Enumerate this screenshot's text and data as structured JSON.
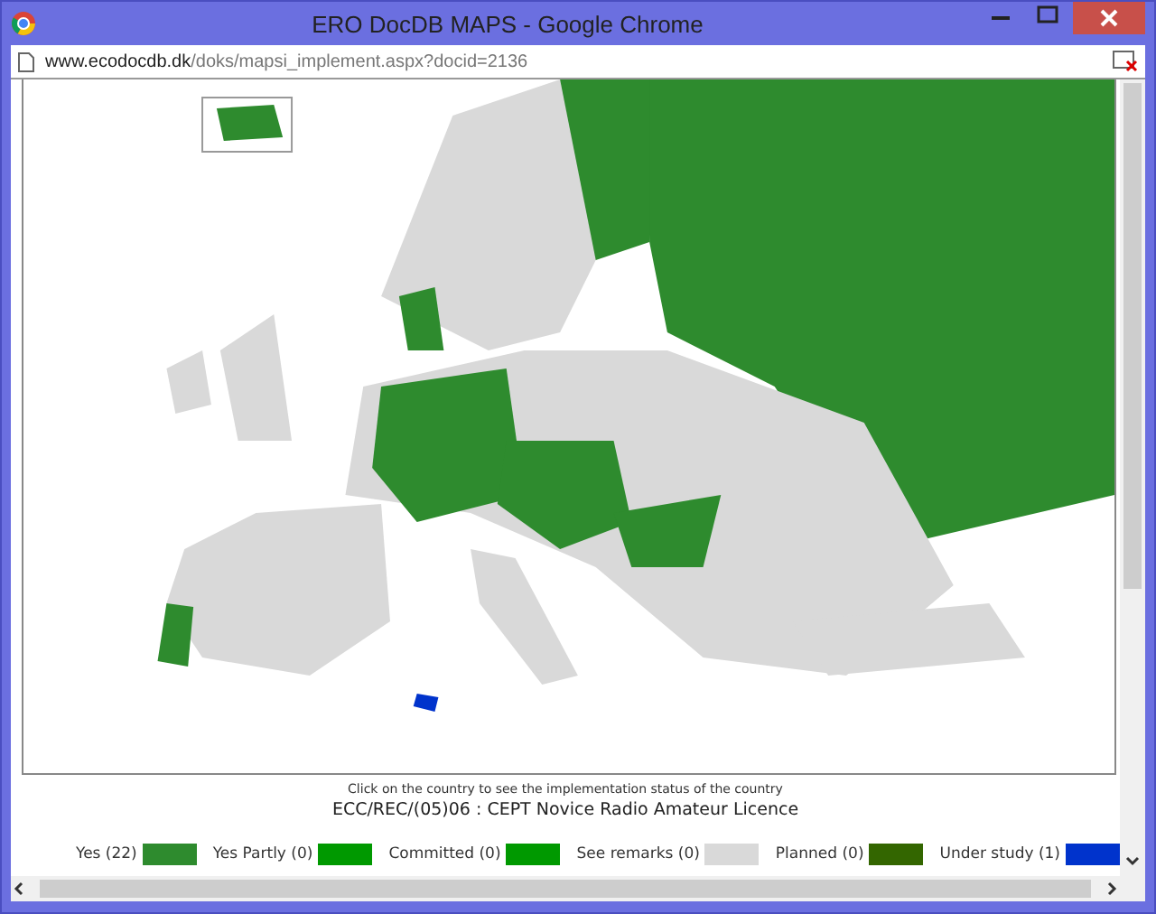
{
  "window": {
    "title": "ERO DocDB MAPS - Google Chrome"
  },
  "address": {
    "domain": "www.ecodocdb.dk",
    "path": "/doks/mapsi_implement.aspx?docid=2136"
  },
  "hint": "Click on the country to see the implementation status of the country",
  "heading": "ECC/REC/(05)06 : CEPT Novice Radio Amateur Licence",
  "legend": [
    {
      "label": "Yes (22)",
      "color": "#2e8b2e"
    },
    {
      "label": "Yes Partly (0)",
      "color": "#009900"
    },
    {
      "label": "Committed (0)",
      "color": "#009900"
    },
    {
      "label": "See remarks (0)",
      "color": "#d9d9d9"
    },
    {
      "label": "Planned (0)",
      "color": "#336600"
    },
    {
      "label": "Under study (1)",
      "color": "#0033cc"
    }
  ]
}
